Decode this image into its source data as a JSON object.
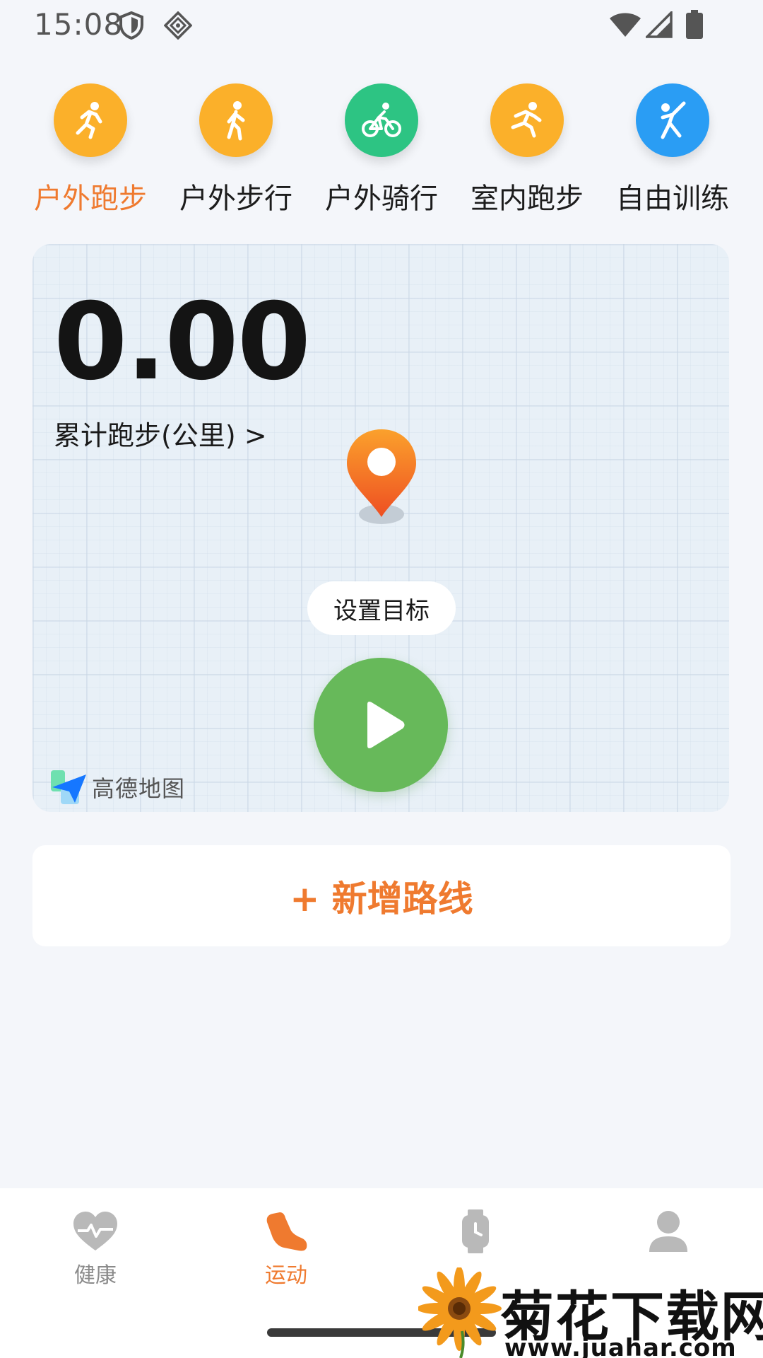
{
  "status_bar": {
    "time": "15:08",
    "icons": [
      "shield-icon",
      "vpn-icon",
      "wifi-icon",
      "signal-icon",
      "battery-icon"
    ]
  },
  "sport_modes": [
    {
      "label": "户外跑步",
      "icon": "running-icon",
      "color": "#fbb02a",
      "active": true
    },
    {
      "label": "户外步行",
      "icon": "walking-icon",
      "color": "#fbb02a",
      "active": false
    },
    {
      "label": "户外骑行",
      "icon": "cycling-icon",
      "color": "#2dc483",
      "active": false
    },
    {
      "label": "室内跑步",
      "icon": "indoor-running-icon",
      "color": "#fbb02a",
      "active": false
    },
    {
      "label": "自由训练",
      "icon": "free-training-icon",
      "color": "#2a9df4",
      "active": false
    }
  ],
  "map_card": {
    "distance_value": "0.00",
    "distance_label": "累计跑步(公里) >",
    "goal_button": "设置目标",
    "start_button_icon": "play-icon",
    "map_provider": "高德地图"
  },
  "add_route": {
    "label": "+ 新增路线"
  },
  "bottom_nav": [
    {
      "label": "健康",
      "icon": "heart-icon",
      "active": false
    },
    {
      "label": "运动",
      "icon": "shoe-icon",
      "active": true
    },
    {
      "label": "",
      "icon": "watch-icon",
      "active": false
    },
    {
      "label": "",
      "icon": "profile-icon",
      "active": false
    }
  ],
  "watermark": {
    "title": "菊花下载网",
    "url": "www.juahar.com"
  },
  "colors": {
    "accent": "#ef7a2f",
    "start_green": "#67b95a",
    "background": "#f4f6fa"
  }
}
